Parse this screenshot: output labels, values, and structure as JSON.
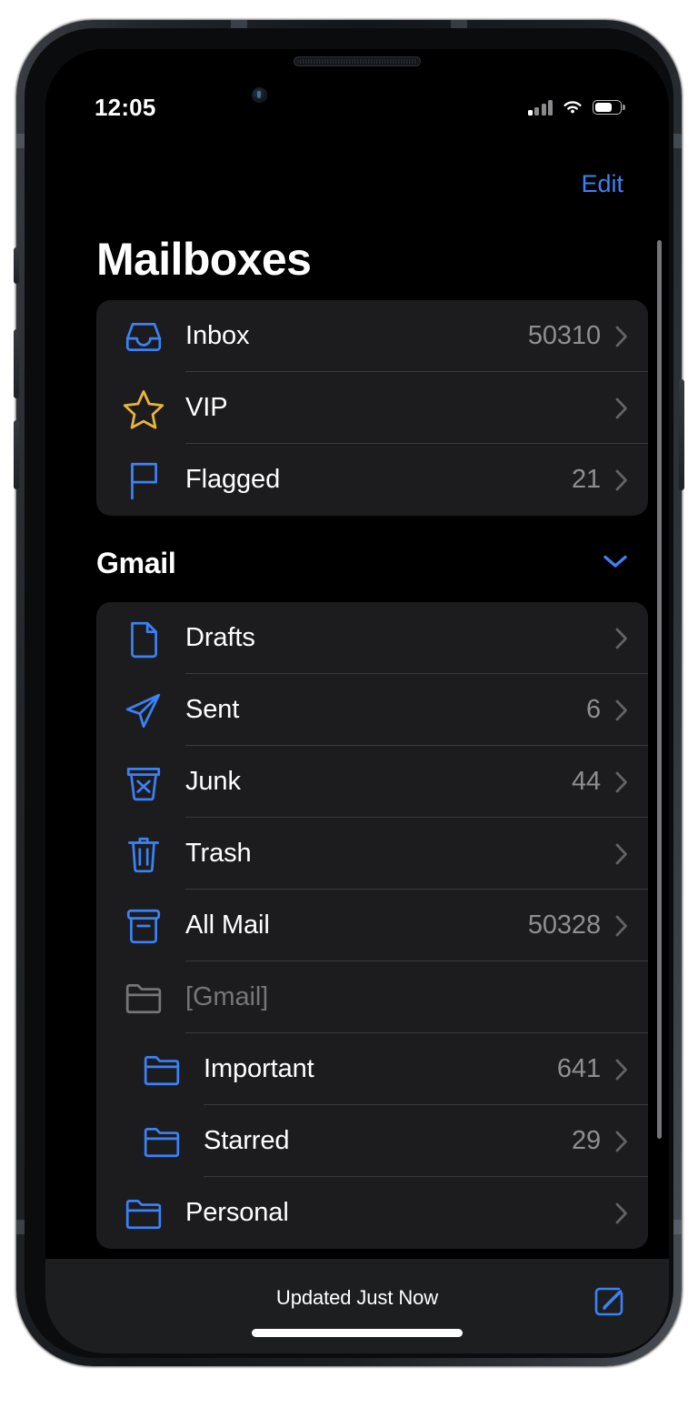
{
  "status_bar": {
    "time": "12:05",
    "signal_icon": "cellular-signal-icon",
    "wifi_icon": "wifi-icon",
    "battery_icon": "battery-icon",
    "battery_level_pct": 62
  },
  "nav": {
    "edit_label": "Edit"
  },
  "header": {
    "title": "Mailboxes"
  },
  "colors": {
    "accent": "#3b82f6",
    "vip_star": "#e8b53c",
    "card_bg": "#1c1c1e",
    "separator": "#3a3a3c",
    "secondary_text": "#8e8e93",
    "disabled_text": "#76767a",
    "screen_bg": "#000000",
    "toolbar_bg": "#1d1e20"
  },
  "favorites": {
    "items": [
      {
        "label": "Inbox",
        "count": "50310",
        "icon": "inbox-tray-icon",
        "icon_color": "#3b82f6",
        "indent": false,
        "disabled": false,
        "chevron": true
      },
      {
        "label": "VIP",
        "count": "",
        "icon": "star-icon",
        "icon_color": "#e8b53c",
        "indent": false,
        "disabled": false,
        "chevron": true
      },
      {
        "label": "Flagged",
        "count": "21",
        "icon": "flag-icon",
        "icon_color": "#3b82f6",
        "indent": false,
        "disabled": false,
        "chevron": true
      }
    ]
  },
  "account_section": {
    "title": "Gmail",
    "collapse_icon": "chevron-down-icon",
    "items": [
      {
        "label": "Drafts",
        "count": "",
        "icon": "document-icon",
        "icon_color": "#3b82f6",
        "indent": false,
        "disabled": false,
        "chevron": true
      },
      {
        "label": "Sent",
        "count": "6",
        "icon": "paper-plane-icon",
        "icon_color": "#3b82f6",
        "indent": false,
        "disabled": false,
        "chevron": true
      },
      {
        "label": "Junk",
        "count": "44",
        "icon": "junk-bin-icon",
        "icon_color": "#3b82f6",
        "indent": false,
        "disabled": false,
        "chevron": true
      },
      {
        "label": "Trash",
        "count": "",
        "icon": "trash-icon",
        "icon_color": "#3b82f6",
        "indent": false,
        "disabled": false,
        "chevron": true
      },
      {
        "label": "All Mail",
        "count": "50328",
        "icon": "archive-box-icon",
        "icon_color": "#3b82f6",
        "indent": false,
        "disabled": false,
        "chevron": true
      },
      {
        "label": "[Gmail]",
        "count": "",
        "icon": "folder-icon",
        "icon_color": "#76767a",
        "indent": false,
        "disabled": true,
        "chevron": false
      },
      {
        "label": "Important",
        "count": "641",
        "icon": "folder-icon",
        "icon_color": "#3b82f6",
        "indent": true,
        "disabled": false,
        "chevron": true
      },
      {
        "label": "Starred",
        "count": "29",
        "icon": "folder-icon",
        "icon_color": "#3b82f6",
        "indent": true,
        "disabled": false,
        "chevron": true
      },
      {
        "label": "Personal",
        "count": "",
        "icon": "folder-icon",
        "icon_color": "#3b82f6",
        "indent": false,
        "disabled": false,
        "chevron": true
      }
    ]
  },
  "toolbar": {
    "status_text": "Updated Just Now",
    "compose_icon": "compose-icon"
  }
}
